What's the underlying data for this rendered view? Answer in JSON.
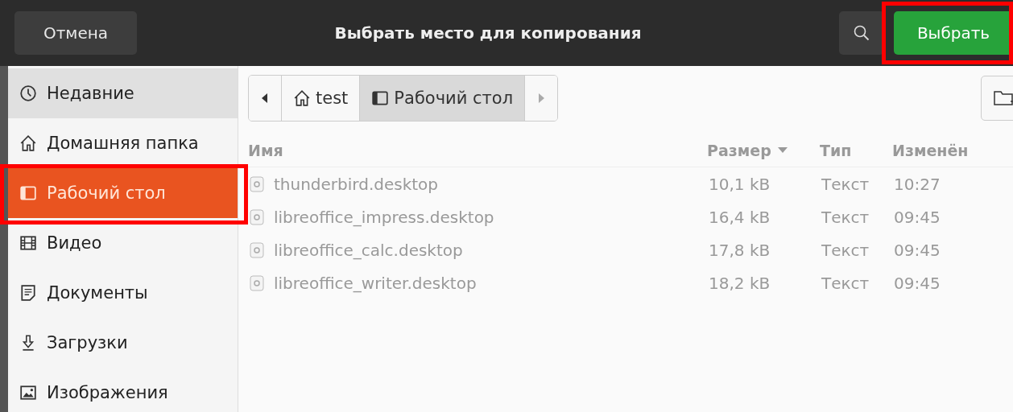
{
  "header": {
    "cancel_button": "Отмена",
    "title": "Выбрать место для копирования",
    "choose_button": {
      "label": "Выбрать",
      "highlighted": true
    }
  },
  "sidebar": {
    "items": [
      {
        "label": "Недавние",
        "kind": "clock",
        "selected": false,
        "hovered": true,
        "highlighted": false
      },
      {
        "label": "Домашняя папка",
        "kind": "home",
        "selected": false,
        "hovered": false,
        "highlighted": false
      },
      {
        "label": "Рабочий стол",
        "kind": "desktop",
        "selected": true,
        "hovered": false,
        "highlighted": true
      },
      {
        "label": "Видео",
        "kind": "film",
        "selected": false,
        "hovered": false,
        "highlighted": false
      },
      {
        "label": "Документы",
        "kind": "document",
        "selected": false,
        "hovered": false,
        "highlighted": false
      },
      {
        "label": "Загрузки",
        "kind": "download",
        "selected": false,
        "hovered": false,
        "highlighted": false
      },
      {
        "label": "Изображения",
        "kind": "image",
        "selected": false,
        "hovered": false,
        "highlighted": false
      }
    ]
  },
  "pathbar": {
    "segments": [
      {
        "label": "test",
        "kind": "home",
        "selected": false
      },
      {
        "label": "Рабочий стол",
        "kind": "desktop",
        "selected": true
      }
    ]
  },
  "table": {
    "columns": [
      {
        "label": "Имя",
        "sorted": false
      },
      {
        "label": "Размер",
        "sorted": true
      },
      {
        "label": "Тип",
        "sorted": false
      },
      {
        "label": "Изменён",
        "sorted": false
      }
    ],
    "rows": [
      [
        "thunderbird.desktop",
        "10,1 kB",
        "Текст",
        "10:27"
      ],
      [
        "libreoffice_impress.desktop",
        "16,4 kB",
        "Текст",
        "09:45"
      ],
      [
        "libreoffice_calc.desktop",
        "17,8 kB",
        "Текст",
        "09:45"
      ],
      [
        "libreoffice_writer.desktop",
        "18,2 kB",
        "Текст",
        "09:45"
      ]
    ]
  }
}
